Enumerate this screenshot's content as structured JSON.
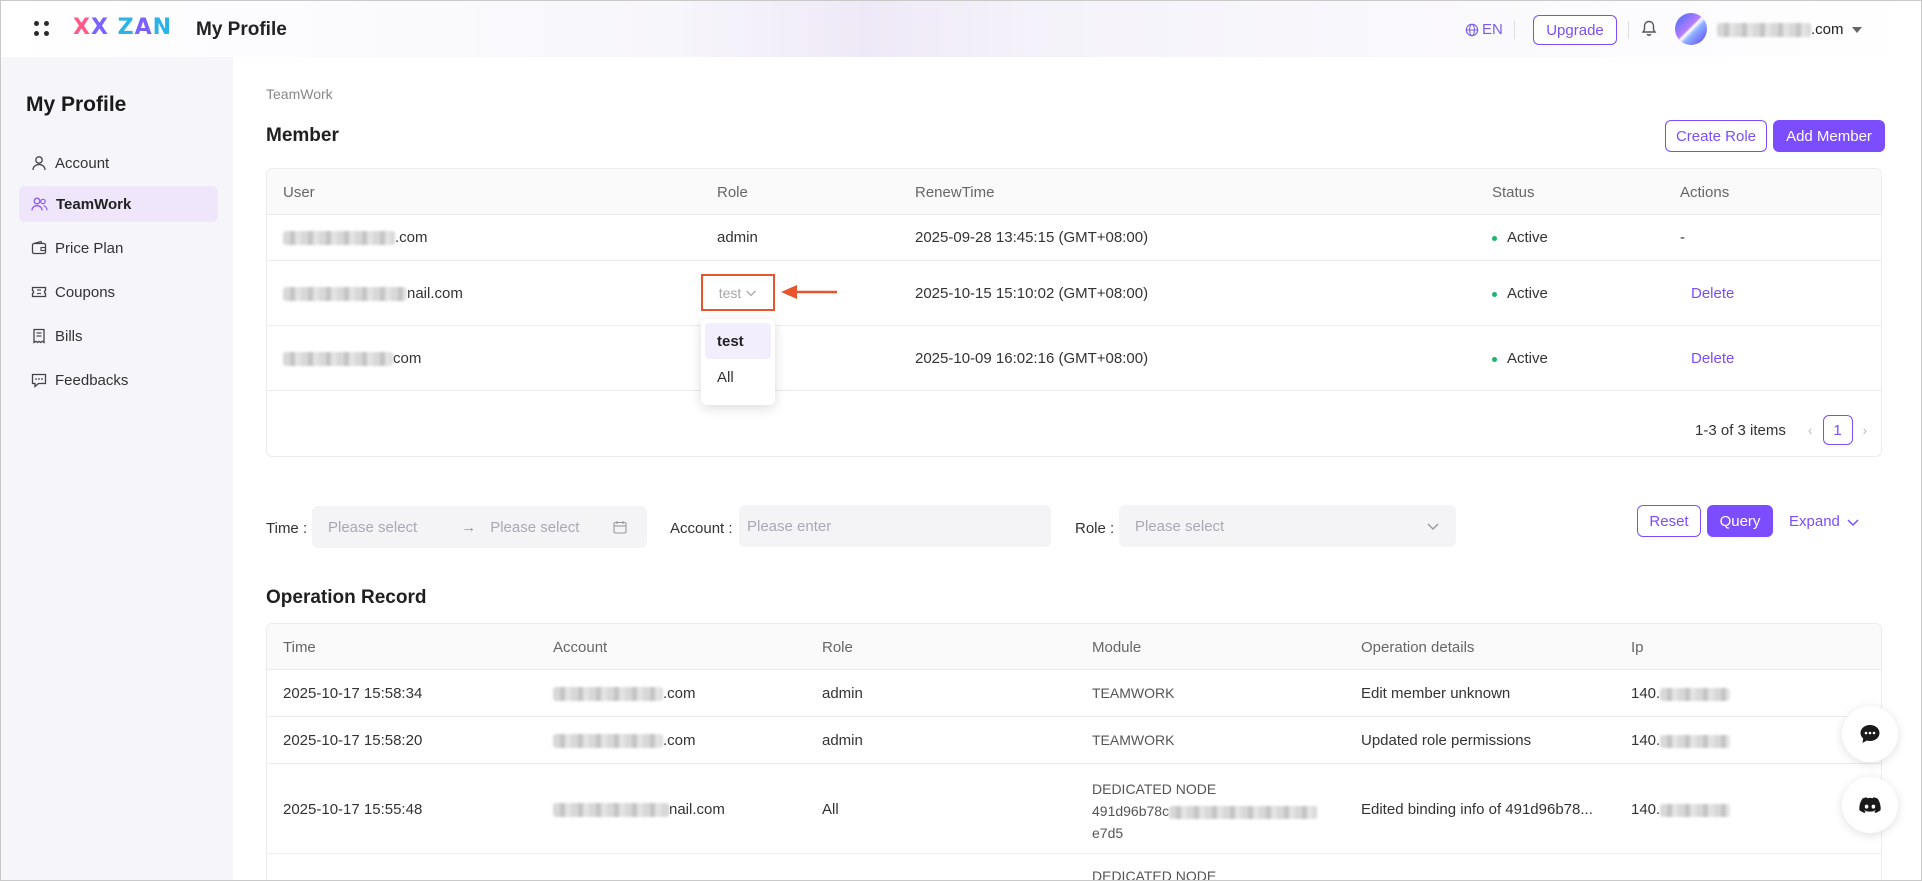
{
  "header": {
    "logo_text": "XX ZAN",
    "title": "My Profile",
    "lang": "EN",
    "upgrade": "Upgrade",
    "user_email_suffix": ".com"
  },
  "sidebar": {
    "title": "My Profile",
    "items": [
      {
        "label": "Account",
        "icon": "user-icon"
      },
      {
        "label": "TeamWork",
        "icon": "team-icon",
        "active": true
      },
      {
        "label": "Price Plan",
        "icon": "wallet-icon"
      },
      {
        "label": "Coupons",
        "icon": "ticket-icon"
      },
      {
        "label": "Bills",
        "icon": "bill-icon"
      },
      {
        "label": "Feedbacks",
        "icon": "message-icon"
      }
    ]
  },
  "main": {
    "breadcrumb": "TeamWork",
    "member_title": "Member",
    "create_role": "Create Role",
    "add_member": "Add Member",
    "member_columns": [
      "User",
      "Role",
      "RenewTime",
      "Status",
      "Actions"
    ],
    "members": [
      {
        "user": ".com",
        "role": "admin",
        "renew": "2025-09-28 13:45:15 (GMT+08:00)",
        "status": "Active",
        "action": "-"
      },
      {
        "user": "nail.com",
        "role": "test",
        "renew": "2025-10-15 15:10:02 (GMT+08:00)",
        "status": "Active",
        "action": "Delete"
      },
      {
        "user": "com",
        "role": "",
        "renew": "2025-10-09 16:02:16 (GMT+08:00)",
        "status": "Active",
        "action": "Delete"
      }
    ],
    "role_dropdown": {
      "current": "test",
      "options": [
        "test",
        "All"
      ]
    },
    "pagination": {
      "summary": "1-3 of 3 items",
      "page": "1"
    },
    "filters": {
      "time_label": "Time",
      "time_start_placeholder": "Please select",
      "time_end_placeholder": "Please select",
      "account_label": "Account",
      "account_placeholder": "Please enter",
      "role_label": "Role",
      "role_placeholder": "Please select",
      "reset": "Reset",
      "query": "Query",
      "expand": "Expand"
    },
    "record_title": "Operation Record",
    "record_columns": [
      "Time",
      "Account",
      "Role",
      "Module",
      "Operation details",
      "Ip"
    ],
    "records": [
      {
        "time": "2025-10-17 15:58:34",
        "account": ".com",
        "role": "admin",
        "module": "TEAMWORK",
        "details": "Edit member unknown",
        "ip": "140."
      },
      {
        "time": "2025-10-17 15:58:20",
        "account": ".com",
        "role": "admin",
        "module": "TEAMWORK",
        "details": "Updated role permissions",
        "ip": "140."
      },
      {
        "time": "2025-10-17 15:55:48",
        "account": "nail.com",
        "role": "All",
        "module_line1": "DEDICATED NODE",
        "module_line2": "491d96b78c",
        "module_line3": "e7d5",
        "details": "Edited binding info of 491d96b78...",
        "ip": "140."
      },
      {
        "module_line1": "DEDICATED NODE"
      }
    ]
  },
  "colors": {
    "accent": "#7c4dff",
    "annotation": "#e8542c",
    "active_status": "#1db56c"
  }
}
